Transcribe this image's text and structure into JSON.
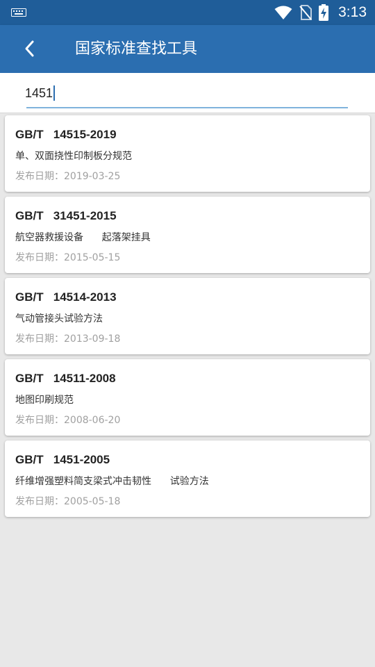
{
  "status_bar": {
    "time": "3:13",
    "icons": [
      "keyboard-icon",
      "wifi-icon",
      "no-sim-icon",
      "battery-charging-icon"
    ]
  },
  "app_bar": {
    "title": "国家标准查找工具",
    "back_icon": "chevron-left-icon"
  },
  "search": {
    "value": "1451"
  },
  "results": [
    {
      "code": "GB/T   14515-2019",
      "name": "单、双面挠性印制板分规范",
      "date": "发布日期：2019-03-25"
    },
    {
      "code": "GB/T   31451-2015",
      "name": "航空器救援设备      起落架挂具",
      "date": "发布日期：2015-05-15"
    },
    {
      "code": "GB/T   14514-2013",
      "name": "气动管接头试验方法",
      "date": "发布日期：2013-09-18"
    },
    {
      "code": "GB/T   14511-2008",
      "name": "地图印刷规范",
      "date": "发布日期：2008-06-20"
    },
    {
      "code": "GB/T   1451-2005",
      "name": "纤维增强塑料简支梁式冲击韧性      试验方法",
      "date": "发布日期：2005-05-18"
    }
  ],
  "colors": {
    "status_bar": "#1f5d99",
    "app_bar": "#2b6eb0",
    "background": "#e8e8e8",
    "accent": "#2b6eb0"
  }
}
